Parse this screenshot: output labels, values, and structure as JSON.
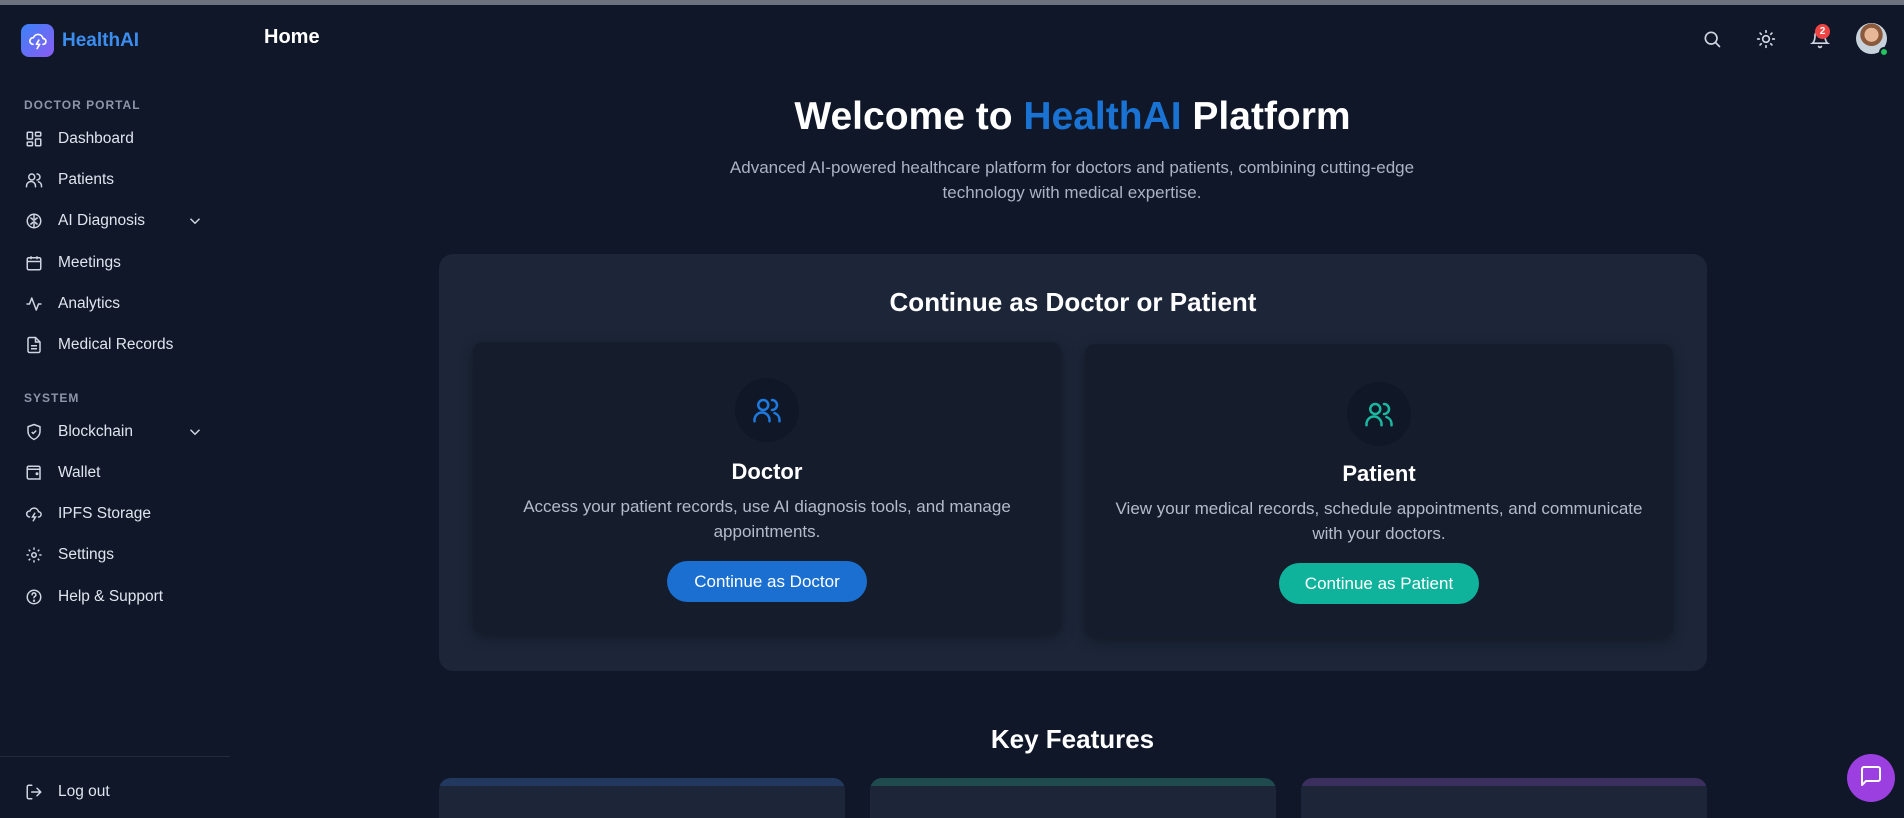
{
  "app": {
    "name": "HealthAI"
  },
  "sidebar": {
    "sections": [
      {
        "label": "DOCTOR PORTAL"
      },
      {
        "label": "SYSTEM"
      }
    ],
    "items": [
      {
        "label": "Dashboard",
        "icon": "dashboard-icon"
      },
      {
        "label": "Patients",
        "icon": "users-icon"
      },
      {
        "label": "AI Diagnosis",
        "icon": "brain-icon",
        "expandable": true
      },
      {
        "label": "Meetings",
        "icon": "calendar-icon"
      },
      {
        "label": "Analytics",
        "icon": "activity-icon"
      },
      {
        "label": "Medical Records",
        "icon": "file-icon"
      },
      {
        "label": "Blockchain",
        "icon": "shield-icon",
        "expandable": true
      },
      {
        "label": "Wallet",
        "icon": "wallet-icon"
      },
      {
        "label": "IPFS Storage",
        "icon": "cloud-icon"
      },
      {
        "label": "Settings",
        "icon": "gear-icon"
      },
      {
        "label": "Help & Support",
        "icon": "help-icon"
      }
    ],
    "logout": "Log out"
  },
  "header": {
    "title": "Home",
    "notification_count": "2"
  },
  "hero": {
    "title_prefix": "Welcome to ",
    "title_accent": "HealthAI",
    "title_suffix": " Platform",
    "subtitle": "Advanced AI-powered healthcare platform for doctors and patients, combining cutting-edge technology with medical expertise."
  },
  "role_select": {
    "title": "Continue as Doctor or Patient",
    "doctor": {
      "title": "Doctor",
      "description": "Access your patient records, use AI diagnosis tools, and manage appointments.",
      "button": "Continue as Doctor"
    },
    "patient": {
      "title": "Patient",
      "description": "View your medical records, schedule appointments, and communicate with your doctors.",
      "button": "Continue as Patient"
    }
  },
  "features": {
    "title": "Key Features"
  },
  "colors": {
    "background": "#0f1729",
    "brand": "#3b8ef0",
    "doctor_accent": "#1a6fd0",
    "patient_accent": "#0fb39c",
    "chat_fab": "#9b3fe0"
  }
}
